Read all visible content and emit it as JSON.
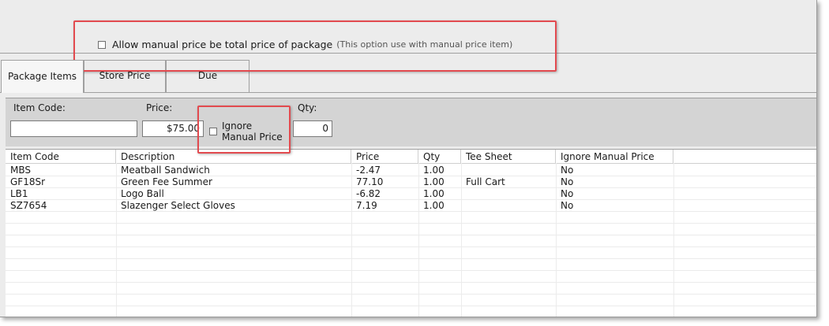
{
  "options": {
    "manual_price_total_label": "Allow manual price be total price of package",
    "manual_price_total_note": "(This option use with manual price item)",
    "manual_price_total_checked": false
  },
  "tabs": [
    {
      "label": "Package Items",
      "active": true
    },
    {
      "label": "Store Price",
      "active": false
    },
    {
      "label": "Due",
      "active": false
    }
  ],
  "entry": {
    "item_code_label": "Item Code:",
    "item_code_value": "",
    "price_label": "Price:",
    "price_value": "$75.00",
    "ignore_line1": "Ignore",
    "ignore_line2": "Manual Price",
    "ignore_checked": false,
    "qty_label": "Qty:",
    "qty_value": "0"
  },
  "grid": {
    "columns": [
      "Item Code",
      "Description",
      "Price",
      "Qty",
      "Tee Sheet",
      "Ignore Manual Price"
    ],
    "rows": [
      [
        "MBS",
        "Meatball Sandwich",
        "-2.47",
        "1.00",
        "",
        "No"
      ],
      [
        "GF18Sr",
        "Green Fee Summer",
        "77.10",
        "1.00",
        "Full Cart",
        "No"
      ],
      [
        "LB1",
        "Logo Ball",
        "-6.82",
        "1.00",
        "",
        "No"
      ],
      [
        "SZ7654",
        "Slazenger Select Gloves",
        "7.19",
        "1.00",
        "",
        "No"
      ]
    ]
  },
  "colors": {
    "callout": "#e24a4f",
    "window_bg": "#ececec",
    "panel_bg": "#d4d4d4"
  }
}
